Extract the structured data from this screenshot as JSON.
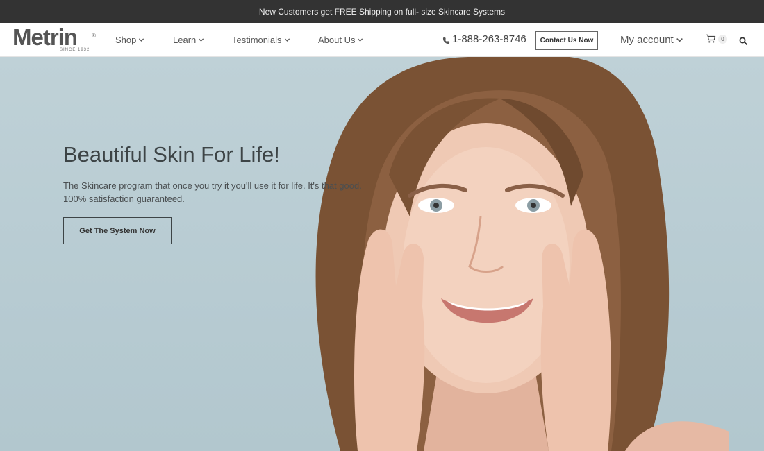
{
  "announcement": "New Customers get FREE Shipping on full- size Skincare Systems",
  "logo": {
    "name": "Metrin",
    "registered": "®",
    "since": "SINCE 1932"
  },
  "nav": [
    {
      "label": "Shop"
    },
    {
      "label": "Learn"
    },
    {
      "label": "Testimonials"
    },
    {
      "label": "About Us"
    }
  ],
  "phone": "1-888-263-8746",
  "contact_button": "Contact Us Now",
  "account_label": "My account",
  "cart_count": "0",
  "hero": {
    "title": "Beautiful Skin For Life!",
    "subtitle": "The Skincare program that once you try it you'll use it for life. It's that good. 100% satisfaction guaranteed.",
    "cta": "Get The System Now"
  },
  "icons": {
    "phone": "phone-icon",
    "cart": "cart-icon",
    "search": "search-icon",
    "dropdown": "chevron-down-icon"
  },
  "colors": {
    "topbar_bg": "#333333",
    "header_bg": "#ffffff",
    "hero_bg": "#b9cdd3",
    "text_dark": "#3d4446"
  }
}
